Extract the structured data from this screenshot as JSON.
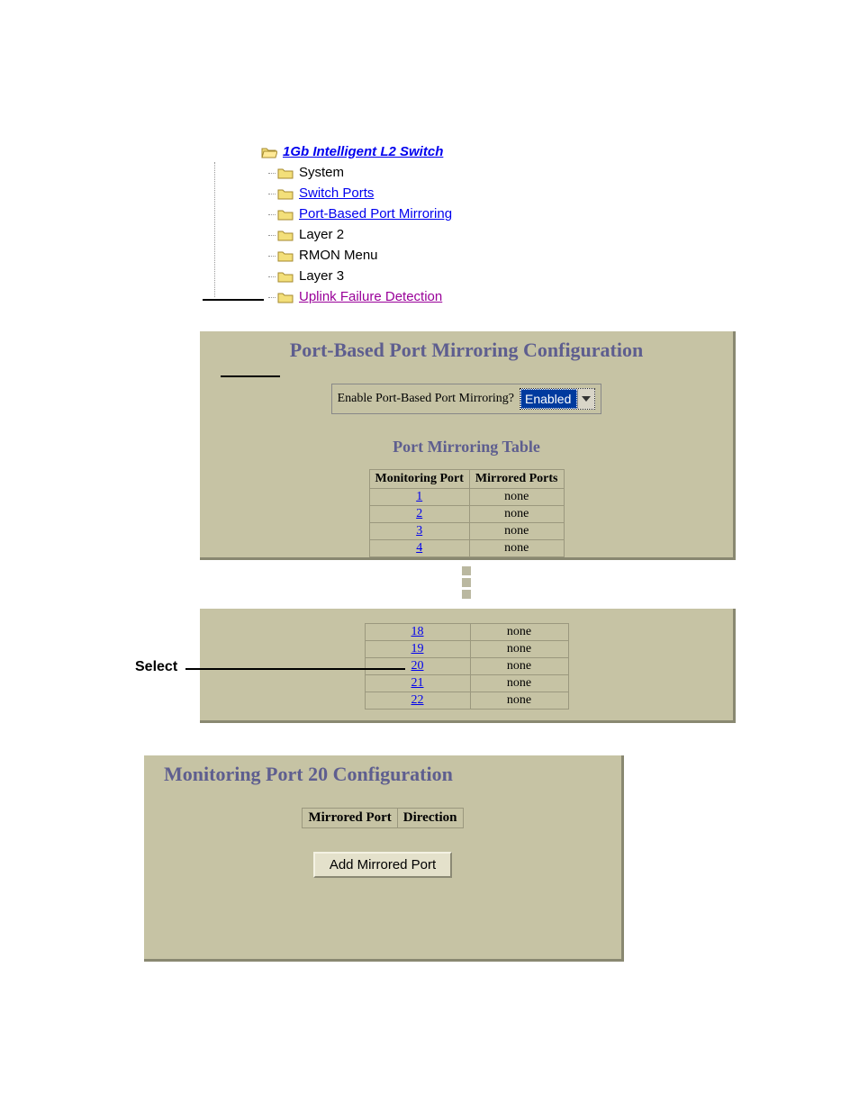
{
  "tree": {
    "root": "1Gb Intelligent L2 Switch",
    "items": [
      {
        "label": "System",
        "kind": "plain"
      },
      {
        "label": "Switch Ports",
        "kind": "blue"
      },
      {
        "label": "Port-Based Port Mirroring",
        "kind": "blue"
      },
      {
        "label": "Layer 2",
        "kind": "plain"
      },
      {
        "label": "RMON Menu",
        "kind": "plain"
      },
      {
        "label": "Layer 3",
        "kind": "plain"
      },
      {
        "label": "Uplink Failure Detection",
        "kind": "purple"
      }
    ]
  },
  "panel1": {
    "title": "Port-Based Port Mirroring Configuration",
    "enable_label": "Enable Port-Based Port Mirroring?",
    "enable_value": "Enabled",
    "table_title": "Port Mirroring Table",
    "col_monitoring": "Monitoring Port",
    "col_mirrored": "Mirrored Ports",
    "rows_top": [
      {
        "port": "1",
        "mirrored": "none"
      },
      {
        "port": "2",
        "mirrored": "none"
      },
      {
        "port": "3",
        "mirrored": "none"
      },
      {
        "port": "4",
        "mirrored": "none"
      }
    ],
    "rows_bottom": [
      {
        "port": "18",
        "mirrored": "none"
      },
      {
        "port": "19",
        "mirrored": "none"
      },
      {
        "port": "20",
        "mirrored": "none"
      },
      {
        "port": "21",
        "mirrored": "none"
      },
      {
        "port": "22",
        "mirrored": "none"
      }
    ]
  },
  "select_callout": "Select",
  "panel3": {
    "title": "Monitoring Port 20 Configuration",
    "col_port": "Mirrored Port",
    "col_dir": "Direction",
    "button": "Add Mirrored Port"
  }
}
